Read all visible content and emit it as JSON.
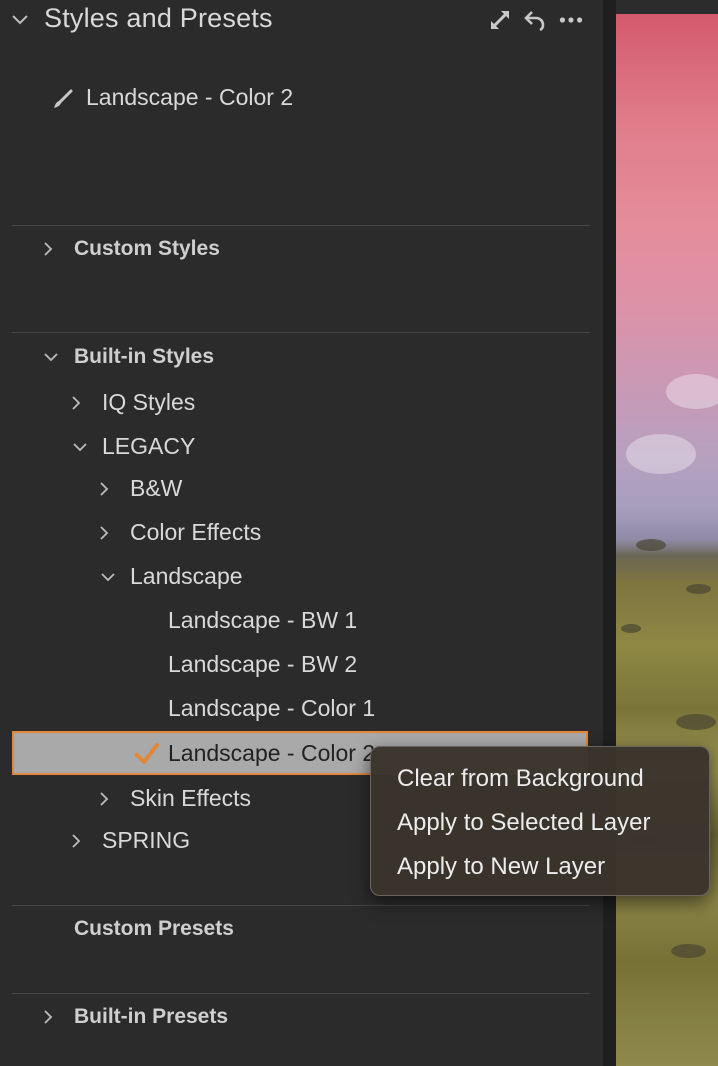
{
  "header": {
    "title": "Styles and Presets"
  },
  "current_style": "Landscape - Color 2",
  "sections": {
    "custom_styles": "Custom Styles",
    "builtin_styles": "Built-in Styles",
    "custom_presets": "Custom Presets",
    "builtin_presets": "Built-in Presets"
  },
  "tree": {
    "iq_styles": "IQ Styles",
    "legacy": "LEGACY",
    "bw": "B&W",
    "color_effects": "Color Effects",
    "landscape": "Landscape",
    "landscape_bw1": "Landscape - BW 1",
    "landscape_bw2": "Landscape - BW 2",
    "landscape_color1": "Landscape - Color 1",
    "landscape_color2": "Landscape - Color 2",
    "skin_effects": "Skin Effects",
    "spring": "SPRING"
  },
  "context_menu": {
    "items": [
      "Clear from Background",
      "Apply to Selected Layer",
      "Apply to New Layer"
    ]
  },
  "colors": {
    "accent": "#e0873a",
    "selection": "#a9a9a9",
    "panel": "#2b2b2b"
  },
  "icons": {
    "header": [
      "chevron-down-icon",
      "expand-icon",
      "undo-icon",
      "more-icon"
    ],
    "current": "brush-icon",
    "selected": "checkmark-icon"
  }
}
